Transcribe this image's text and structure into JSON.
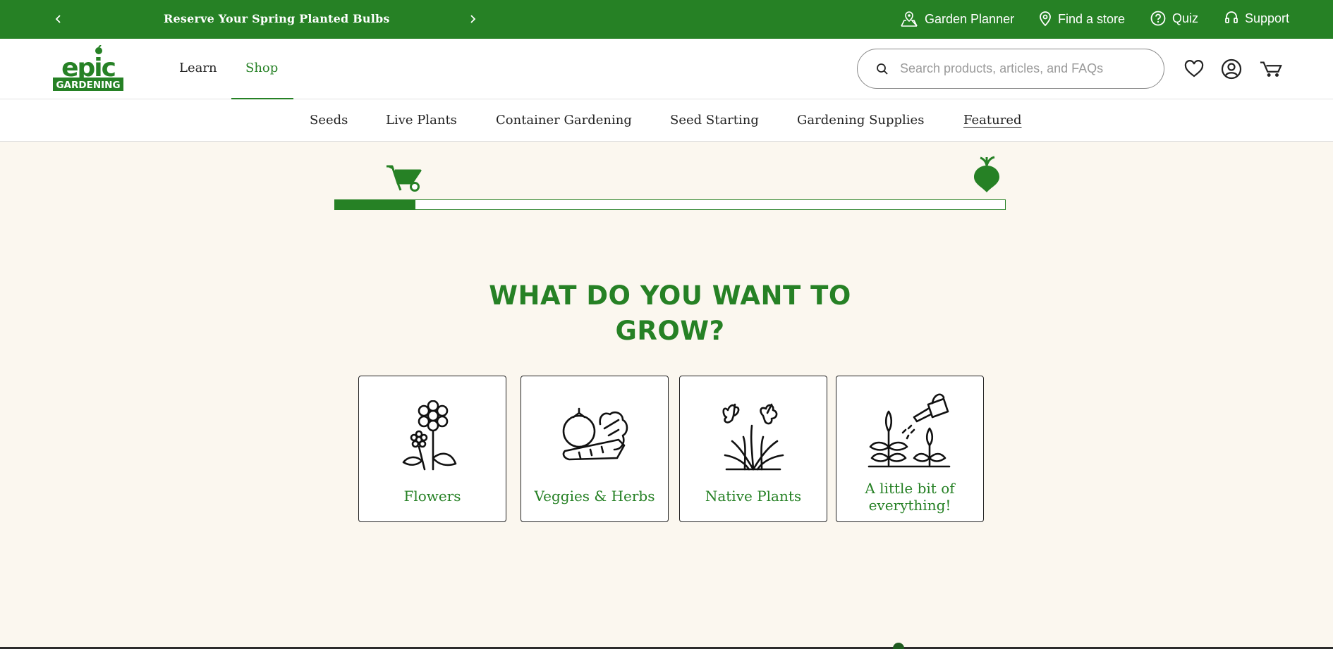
{
  "colors": {
    "brand_green": "#268125",
    "background": "#fbf7ef"
  },
  "promo": {
    "text": "Reserve Your Spring Planted Bulbs",
    "prev_icon": "chevron-left-icon",
    "next_icon": "chevron-right-icon"
  },
  "utility_links": [
    {
      "label": "Garden Planner",
      "icon": "garden-planner-icon"
    },
    {
      "label": "Find a store",
      "icon": "location-pin-icon"
    },
    {
      "label": "Quiz",
      "icon": "question-circle-icon"
    },
    {
      "label": "Support",
      "icon": "headset-icon"
    }
  ],
  "logo": {
    "top": "epic",
    "bottom": "GARDENING"
  },
  "main_nav": {
    "learn": "Learn",
    "shop": "Shop"
  },
  "search": {
    "placeholder": "Search products, articles, and FAQs",
    "value": ""
  },
  "header_icons": [
    "heart-icon",
    "account-icon",
    "cart-wheelbarrow-icon"
  ],
  "categories": [
    "Seeds",
    "Live Plants",
    "Container Gardening",
    "Seed Starting",
    "Gardening Supplies",
    "Featured"
  ],
  "progress": {
    "fraction": 0.12,
    "start_icon": "wheelbarrow-icon",
    "end_icon": "turnip-icon"
  },
  "quiz": {
    "question": "WHAT DO YOU WANT TO GROW?",
    "options": [
      {
        "label": "Flowers",
        "icon": "flower-icon"
      },
      {
        "label": "Veggies & Herbs",
        "icon": "vegetables-icon"
      },
      {
        "label": "Native Plants",
        "icon": "native-plants-icon"
      },
      {
        "label": "A little bit of everything!",
        "icon": "watering-can-icon"
      }
    ]
  }
}
